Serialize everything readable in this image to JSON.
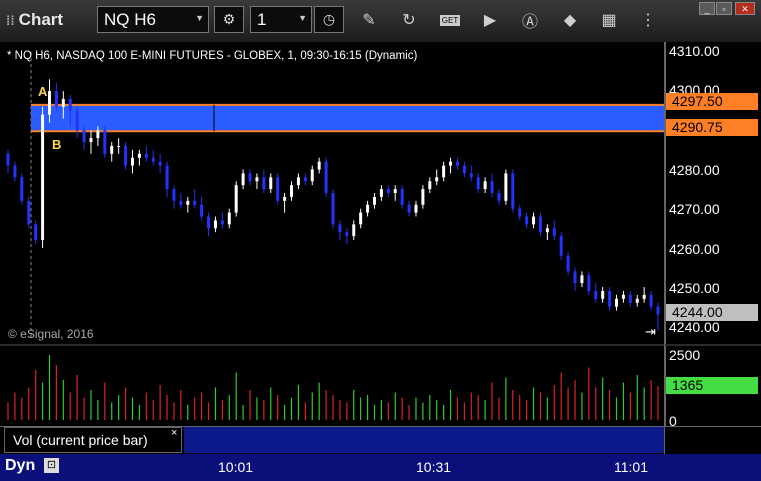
{
  "window": {
    "title": "Chart",
    "symbol": "NQ H6",
    "interval": "1",
    "buttons": {
      "minimize": "_",
      "restore": "▫",
      "close": "✕"
    }
  },
  "toolbar": {
    "icons": [
      "settings-icon",
      "clock-icon",
      "pencil-icon",
      "refresh-icon",
      "get-icon",
      "play-icon",
      "alert-icon",
      "tag-icon",
      "grid-icon",
      "more-icon"
    ],
    "get_label": "GET"
  },
  "chart": {
    "header": "* NQ H6, NASDAQ 100 E-MINI FUTURES - GLOBEX, 1, 09:30-16:15 (Dynamic)",
    "watermark": "© eSignal, 2016",
    "label_a": "A",
    "label_b": "B",
    "price_ticks": [
      "4310.00",
      "4300.00",
      "4280.00",
      "4270.00",
      "4260.00",
      "4250.00",
      "4240.00"
    ],
    "zone_top_label": "4297.50",
    "zone_bottom_label": "4290.75",
    "last_price_label": "4244.00",
    "colors": {
      "zone": "#2a5cff",
      "zone_border": "#ff7f27",
      "up": "#ffffff",
      "down": "#2233ff",
      "last_price_tag": "#bfbfbf"
    }
  },
  "volume": {
    "study_name": "Vol (current price bar)",
    "close_glyph": "×",
    "axis_ticks": [
      "2500",
      "0"
    ],
    "current_value": "1365",
    "colors": {
      "up": "#2ecc2e",
      "down": "#dd2222",
      "current_tag": "#44dd44"
    }
  },
  "time_axis": {
    "mode": "Dyn",
    "lock_glyph": "🔒",
    "labels": [
      "10:01",
      "10:31",
      "11:01"
    ]
  },
  "chart_data": {
    "type": "candlestick",
    "symbol": "NQ H6",
    "interval": "1 minute",
    "ylim": [
      4238,
      4312
    ],
    "x_ticks": [
      "10:01",
      "10:31",
      "11:01"
    ],
    "zone": {
      "top": 4297.5,
      "bottom": 4290.75
    },
    "last_price": 4244.0,
    "candles": [
      [
        4285,
        4286,
        4280,
        4282
      ],
      [
        4282,
        4283,
        4278,
        4279
      ],
      [
        4279,
        4280,
        4272,
        4273
      ],
      [
        4273,
        4274,
        4266,
        4267
      ],
      [
        4267,
        4268,
        4262,
        4263
      ],
      [
        4263,
        4297,
        4261,
        4295
      ],
      [
        4295,
        4304,
        4293,
        4301
      ],
      [
        4301,
        4303,
        4296,
        4297
      ],
      [
        4297,
        4301,
        4294,
        4299
      ],
      [
        4299,
        4300,
        4292,
        4296
      ],
      [
        4296,
        4297,
        4289,
        4291
      ],
      [
        4291,
        4292,
        4286,
        4288
      ],
      [
        4288,
        4291,
        4285,
        4289
      ],
      [
        4289,
        4292,
        4287,
        4291
      ],
      [
        4291,
        4292,
        4284,
        4285
      ],
      [
        4285,
        4288,
        4283,
        4287
      ],
      [
        4287,
        4289,
        4285,
        4287
      ],
      [
        4287,
        4288,
        4281,
        4282
      ],
      [
        4282,
        4286,
        4280,
        4284
      ],
      [
        4284,
        4286,
        4282,
        4285
      ],
      [
        4285,
        4287,
        4283,
        4284
      ],
      [
        4284,
        4286,
        4282,
        4283
      ],
      [
        4283,
        4285,
        4280,
        4282
      ],
      [
        4282,
        4283,
        4274,
        4276
      ],
      [
        4276,
        4277,
        4271,
        4273
      ],
      [
        4273,
        4275,
        4271,
        4272
      ],
      [
        4272,
        4274,
        4270,
        4273
      ],
      [
        4273,
        4276,
        4271,
        4272
      ],
      [
        4272,
        4274,
        4268,
        4269
      ],
      [
        4269,
        4270,
        4264,
        4266
      ],
      [
        4266,
        4269,
        4265,
        4268
      ],
      [
        4268,
        4270,
        4266,
        4267
      ],
      [
        4267,
        4271,
        4266,
        4270
      ],
      [
        4270,
        4278,
        4269,
        4277
      ],
      [
        4277,
        4281,
        4276,
        4280
      ],
      [
        4280,
        4281,
        4277,
        4278
      ],
      [
        4278,
        4280,
        4276,
        4279
      ],
      [
        4279,
        4281,
        4275,
        4276
      ],
      [
        4276,
        4280,
        4275,
        4279
      ],
      [
        4279,
        4280,
        4272,
        4273
      ],
      [
        4273,
        4275,
        4270,
        4274
      ],
      [
        4274,
        4278,
        4273,
        4277
      ],
      [
        4277,
        4280,
        4276,
        4279
      ],
      [
        4279,
        4280,
        4277,
        4278
      ],
      [
        4278,
        4282,
        4277,
        4281
      ],
      [
        4281,
        4284,
        4280,
        4283
      ],
      [
        4283,
        4284,
        4274,
        4275
      ],
      [
        4275,
        4276,
        4266,
        4267
      ],
      [
        4267,
        4268,
        4263,
        4265
      ],
      [
        4265,
        4266,
        4262,
        4264
      ],
      [
        4264,
        4268,
        4263,
        4267
      ],
      [
        4267,
        4271,
        4266,
        4270
      ],
      [
        4270,
        4273,
        4269,
        4272
      ],
      [
        4272,
        4275,
        4271,
        4274
      ],
      [
        4274,
        4277,
        4273,
        4276
      ],
      [
        4276,
        4277,
        4274,
        4275
      ],
      [
        4275,
        4277,
        4273,
        4276
      ],
      [
        4276,
        4277,
        4271,
        4272
      ],
      [
        4272,
        4273,
        4269,
        4270
      ],
      [
        4270,
        4273,
        4269,
        4272
      ],
      [
        4272,
        4277,
        4271,
        4276
      ],
      [
        4276,
        4279,
        4275,
        4278
      ],
      [
        4278,
        4281,
        4277,
        4279
      ],
      [
        4279,
        4283,
        4278,
        4282
      ],
      [
        4282,
        4284,
        4280,
        4283
      ],
      [
        4283,
        4284,
        4281,
        4282
      ],
      [
        4282,
        4283,
        4279,
        4280
      ],
      [
        4280,
        4282,
        4278,
        4279
      ],
      [
        4279,
        4280,
        4275,
        4276
      ],
      [
        4276,
        4279,
        4275,
        4278
      ],
      [
        4278,
        4280,
        4274,
        4275
      ],
      [
        4275,
        4276,
        4272,
        4273
      ],
      [
        4273,
        4281,
        4272,
        4280
      ],
      [
        4280,
        4281,
        4270,
        4271
      ],
      [
        4271,
        4272,
        4268,
        4269
      ],
      [
        4269,
        4270,
        4266,
        4267
      ],
      [
        4267,
        4270,
        4266,
        4269
      ],
      [
        4269,
        4270,
        4264,
        4265
      ],
      [
        4265,
        4267,
        4263,
        4266
      ],
      [
        4266,
        4268,
        4263,
        4264
      ],
      [
        4264,
        4265,
        4258,
        4259
      ],
      [
        4259,
        4260,
        4254,
        4255
      ],
      [
        4255,
        4256,
        4250,
        4252
      ],
      [
        4252,
        4255,
        4251,
        4254
      ],
      [
        4254,
        4255,
        4249,
        4250
      ],
      [
        4250,
        4252,
        4247,
        4248
      ],
      [
        4248,
        4251,
        4247,
        4250
      ],
      [
        4250,
        4251,
        4245,
        4246
      ],
      [
        4246,
        4249,
        4245,
        4248
      ],
      [
        4248,
        4250,
        4247,
        4249
      ],
      [
        4249,
        4250,
        4246,
        4247
      ],
      [
        4247,
        4249,
        4246,
        4248
      ],
      [
        4248,
        4251,
        4247,
        4249
      ],
      [
        4249,
        4250,
        4245,
        4246
      ],
      [
        4246,
        4247,
        4240,
        4244
      ]
    ],
    "volume": {
      "ylim": [
        0,
        2800
      ],
      "values": [
        700,
        1100,
        900,
        1300,
        2000,
        1500,
        2600,
        2200,
        1600,
        1100,
        1800,
        900,
        1200,
        800,
        1500,
        700,
        1000,
        1300,
        900,
        600,
        1100,
        800,
        1400,
        1000,
        700,
        1200,
        600,
        900,
        1100,
        700,
        1300,
        800,
        1000,
        1900,
        600,
        1200,
        900,
        800,
        1300,
        1000,
        600,
        900,
        1400,
        700,
        1100,
        1500,
        1200,
        1000,
        800,
        700,
        1200,
        900,
        1000,
        600,
        800,
        700,
        1100,
        900,
        600,
        900,
        700,
        1000,
        800,
        600,
        1200,
        900,
        700,
        1100,
        1000,
        800,
        1500,
        900,
        1700,
        1200,
        1000,
        800,
        1300,
        1100,
        900,
        1400,
        1900,
        1300,
        1600,
        1100,
        2100,
        1300,
        1700,
        1200,
        900,
        1500,
        1100,
        1800,
        1300,
        1600,
        1365
      ]
    }
  }
}
